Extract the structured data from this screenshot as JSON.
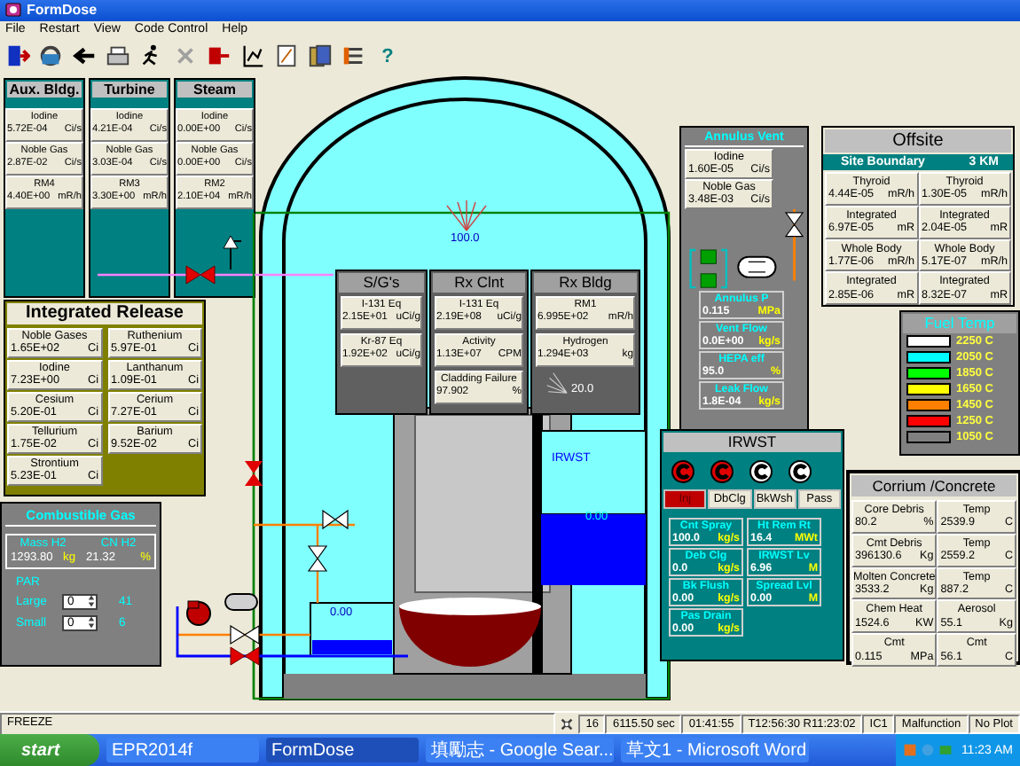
{
  "window": {
    "title": "FormDose"
  },
  "menu": [
    "File",
    "Restart",
    "View",
    "Code Control",
    "Help"
  ],
  "help_glyph": "?",
  "release_points": [
    {
      "title": "Aux. Bldg.",
      "cells": [
        {
          "label": "Iodine",
          "value": "5.72E-04",
          "unit": "Ci/s"
        },
        {
          "label": "Noble Gas",
          "value": "2.87E-02",
          "unit": "Ci/s"
        },
        {
          "label": "RM4",
          "value": "4.40E+00",
          "unit": "mR/h"
        }
      ]
    },
    {
      "title": "Turbine",
      "cells": [
        {
          "label": "Iodine",
          "value": "4.21E-04",
          "unit": "Ci/s"
        },
        {
          "label": "Noble Gas",
          "value": "3.03E-04",
          "unit": "Ci/s"
        },
        {
          "label": "RM3",
          "value": "3.30E+00",
          "unit": "mR/h"
        }
      ]
    },
    {
      "title": "Steam",
      "cells": [
        {
          "label": "Iodine",
          "value": "0.00E+00",
          "unit": "Ci/s"
        },
        {
          "label": "Noble Gas",
          "value": "0.00E+00",
          "unit": "Ci/s"
        },
        {
          "label": "RM2",
          "value": "2.10E+04",
          "unit": "mR/h"
        }
      ]
    }
  ],
  "integrated_release": {
    "title": "Integrated Release",
    "cells": [
      {
        "label": "Noble Gases",
        "value": "1.65E+02",
        "unit": "Ci"
      },
      {
        "label": "Ruthenium",
        "value": "5.97E-01",
        "unit": "Ci"
      },
      {
        "label": "Iodine",
        "value": "7.23E+00",
        "unit": "Ci"
      },
      {
        "label": "Lanthanum",
        "value": "1.09E-01",
        "unit": "Ci"
      },
      {
        "label": "Cesium",
        "value": "5.20E-01",
        "unit": "Ci"
      },
      {
        "label": "Cerium",
        "value": "7.27E-01",
        "unit": "Ci"
      },
      {
        "label": "Tellurium",
        "value": "1.75E-02",
        "unit": "Ci"
      },
      {
        "label": "Barium",
        "value": "9.52E-02",
        "unit": "Ci"
      },
      {
        "label": "Strontium",
        "value": "5.23E-01",
        "unit": "Ci"
      }
    ]
  },
  "combustible_gas": {
    "title": "Combustible Gas",
    "readings": [
      {
        "label": "Mass H2",
        "value": "1293.80",
        "unit": "kg"
      },
      {
        "label": "CN H2",
        "value": "21.32",
        "unit": "%"
      }
    ],
    "par_label": "PAR",
    "par": [
      {
        "label": "Large",
        "value": "0",
        "count": "41"
      },
      {
        "label": "Small",
        "value": "0",
        "count": "6"
      }
    ]
  },
  "containment": {
    "dome_gauge": "100.0",
    "irwst_label": "IRWST",
    "irwst_level": "0.00",
    "tank_level": "0.00"
  },
  "plant_panels": [
    {
      "title": "S/G's",
      "cells": [
        {
          "label": "I-131 Eq",
          "value": "2.15E+01",
          "unit": "uCi/g"
        },
        {
          "label": "Kr-87 Eq",
          "value": "1.92E+02",
          "unit": "uCi/g"
        }
      ]
    },
    {
      "title": "Rx Clnt",
      "cells": [
        {
          "label": "I-131 Eq",
          "value": "2.19E+08",
          "unit": "uCi/g"
        },
        {
          "label": "Activity",
          "value": "1.13E+07",
          "unit": "CPM"
        },
        {
          "label": "Cladding Failure",
          "value": "97.902",
          "unit": "%"
        }
      ]
    },
    {
      "title": "Rx Bldg",
      "cells": [
        {
          "label": "RM1",
          "value": "6.995E+02",
          "unit": "mR/h"
        },
        {
          "label": "Hydrogen",
          "value": "1.294E+03",
          "unit": "kg"
        }
      ],
      "gauge": "20.0"
    }
  ],
  "annulus_vent": {
    "title": "Annulus Vent",
    "cells": [
      {
        "label": "Iodine",
        "value": "1.60E-05",
        "unit": "Ci/s"
      },
      {
        "label": "Noble Gas",
        "value": "3.48E-03",
        "unit": "Ci/s"
      }
    ],
    "readings": [
      {
        "label": "Annulus P",
        "value": "0.115",
        "unit": "MPa"
      },
      {
        "label": "Vent Flow",
        "value": "0.0E+00",
        "unit": "kg/s"
      },
      {
        "label": "HEPA eff",
        "value": "95.0",
        "unit": "%"
      },
      {
        "label": "Leak Flow",
        "value": "1.8E-04",
        "unit": "kg/s"
      }
    ]
  },
  "offsite": {
    "title": "Offsite",
    "distance_label": "Site Boundary",
    "distance": "3 KM",
    "cells": [
      {
        "label": "Thyroid",
        "value": "4.44E-05",
        "unit": "mR/h"
      },
      {
        "label": "Thyroid",
        "value": "1.30E-05",
        "unit": "mR/h"
      },
      {
        "label": "Integrated",
        "value": "6.97E-05",
        "unit": "mR"
      },
      {
        "label": "Integrated",
        "value": "2.04E-05",
        "unit": "mR"
      },
      {
        "label": "Whole Body",
        "value": "1.77E-06",
        "unit": "mR/h"
      },
      {
        "label": "Whole Body",
        "value": "5.17E-07",
        "unit": "mR/h"
      },
      {
        "label": "Integrated",
        "value": "2.85E-06",
        "unit": "mR"
      },
      {
        "label": "Integrated",
        "value": "8.32E-07",
        "unit": "mR"
      }
    ]
  },
  "fuel_temp": {
    "title": "Fuel Temp",
    "scale": [
      {
        "color": "#ffffff",
        "label": "2250 C"
      },
      {
        "color": "#00ffff",
        "label": "2050 C"
      },
      {
        "color": "#00ff00",
        "label": "1850 C"
      },
      {
        "color": "#ffff00",
        "label": "1650 C"
      },
      {
        "color": "#ff8000",
        "label": "1450 C"
      },
      {
        "color": "#ff0000",
        "label": "1250 C"
      },
      {
        "color": "#808080",
        "label": "1050 C"
      }
    ]
  },
  "irwst": {
    "title": "IRWST",
    "pumps": [
      {
        "on": true
      },
      {
        "on": true
      },
      {
        "on": false
      },
      {
        "on": false
      }
    ],
    "modes": [
      {
        "label": "Inj",
        "selected": true
      },
      {
        "label": "DbClg",
        "selected": false
      },
      {
        "label": "BkWsh",
        "selected": false
      },
      {
        "label": "Pass",
        "selected": false
      }
    ],
    "readings": [
      {
        "label": "Cnt Spray",
        "value": "100.0",
        "unit": "kg/s"
      },
      {
        "label": "Ht Rem Rt",
        "value": "16.4",
        "unit": "MWt"
      },
      {
        "label": "Deb Clg",
        "value": "0.0",
        "unit": "kg/s"
      },
      {
        "label": "IRWST Lv",
        "value": "6.96",
        "unit": "M"
      },
      {
        "label": "Bk Flush",
        "value": "0.00",
        "unit": "kg/s"
      },
      {
        "label": "Spread Lvl",
        "value": "0.00",
        "unit": "M"
      },
      {
        "label": "Pas Drain",
        "value": "0.00",
        "unit": "kg/s"
      }
    ]
  },
  "corrium": {
    "title": "Corrium /Concrete",
    "cells": [
      {
        "label": "Core Debris",
        "value": "80.2",
        "unit": "%"
      },
      {
        "label": "Temp",
        "value": "2539.9",
        "unit": "C"
      },
      {
        "label": "Cmt Debris",
        "value": "396130.6",
        "unit": "Kg"
      },
      {
        "label": "Temp",
        "value": "2559.2",
        "unit": "C"
      },
      {
        "label": "Molten Concrete",
        "value": "3533.2",
        "unit": "Kg"
      },
      {
        "label": "Temp",
        "value": "887.2",
        "unit": "C"
      },
      {
        "label": "Chem Heat",
        "value": "1524.6",
        "unit": "KW"
      },
      {
        "label": "Aerosol",
        "value": "55.1",
        "unit": "Kg"
      },
      {
        "label": "Cmt",
        "value": "0.115",
        "unit": "MPa"
      },
      {
        "label": "Cmt",
        "value": "56.1",
        "unit": "C"
      }
    ]
  },
  "status_bar": {
    "mode": "FREEZE",
    "fields": [
      "16",
      "6115.50 sec",
      "01:41:55",
      "T12:56:30 R11:23:02",
      "IC1",
      "Malfunction",
      "No Plot"
    ]
  },
  "taskbar": {
    "start": "start",
    "tasks": [
      {
        "label": "EPR2014f",
        "selected": false
      },
      {
        "label": "FormDose",
        "selected": true
      },
      {
        "label": "填勵志 - Google Sear...",
        "selected": false
      },
      {
        "label": "草文1 - Microsoft Word",
        "selected": false
      }
    ],
    "clock": "11:23 AM"
  }
}
